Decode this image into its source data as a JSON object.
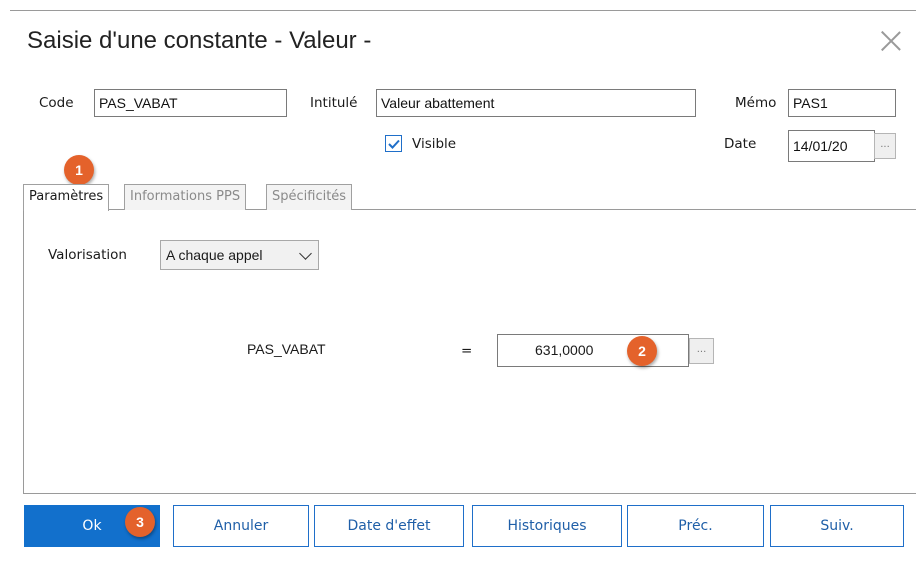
{
  "window": {
    "title": "Saisie d'une constante - Valeur -"
  },
  "header": {
    "code_label": "Code",
    "code_value": "PAS_VABAT",
    "intitule_label": "Intitulé",
    "intitule_value": "Valeur abattement",
    "memo_label": "Mémo",
    "memo_value": "PAS1",
    "visible_label": "Visible",
    "visible_checked": true,
    "date_label": "Date",
    "date_value": "14/01/20",
    "date_button": "..."
  },
  "tabs": [
    {
      "label": "Paramètres",
      "active": true
    },
    {
      "label": "Informations PPS",
      "active": false
    },
    {
      "label": "Spécificités",
      "active": false
    }
  ],
  "params": {
    "valorisation_label": "Valorisation",
    "valorisation_value": "A chaque appel",
    "formula_name": "PAS_VABAT",
    "equals": "=",
    "value": "631,0000",
    "value_button": "..."
  },
  "badges": [
    "1",
    "2",
    "3"
  ],
  "buttons": {
    "ok": "Ok",
    "annuler": "Annuler",
    "date_effet": "Date d'effet",
    "historiques": "Historiques",
    "prec": "Préc.",
    "suiv": "Suiv."
  },
  "colors": {
    "accent": "#1270cc",
    "badge": "#e4622b",
    "checkbox": "#1f6fc9"
  }
}
